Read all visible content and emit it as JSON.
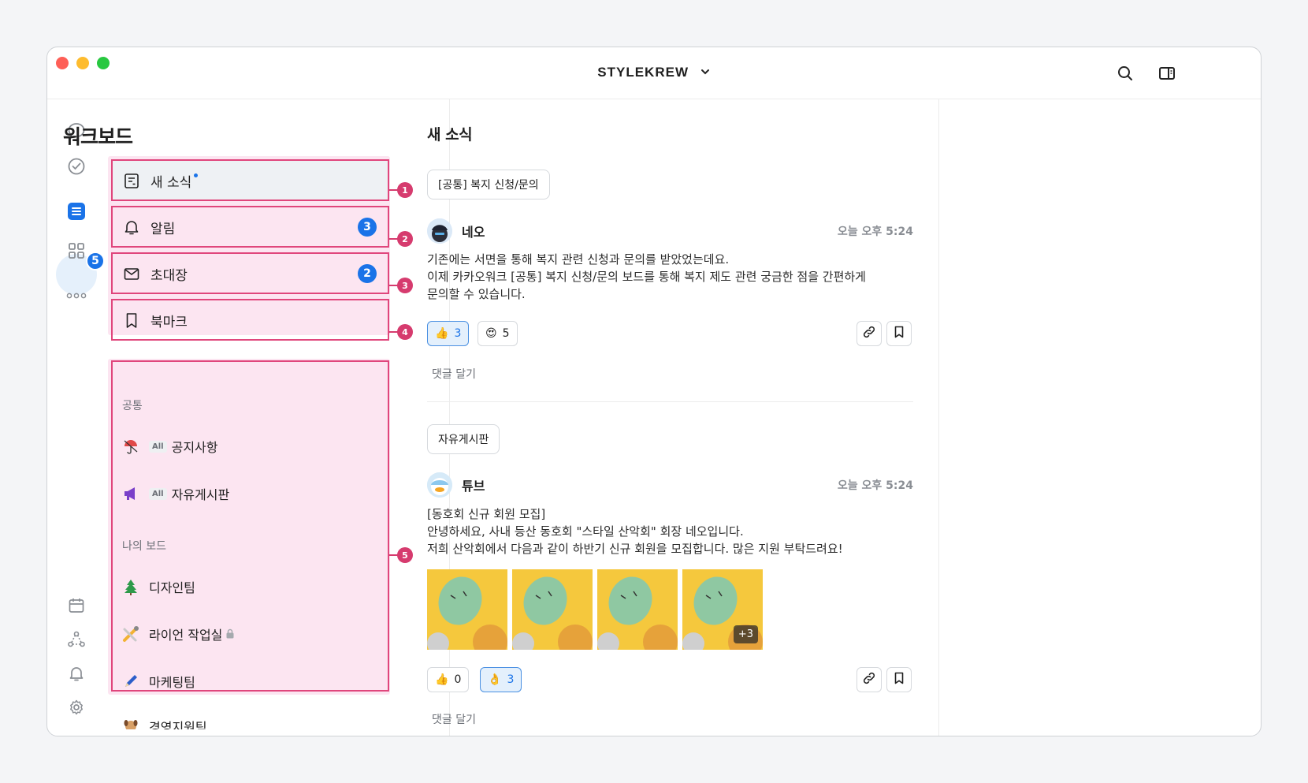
{
  "window": {
    "workspace_name": "STYLEKREW"
  },
  "rail": {
    "board_badge": "5"
  },
  "board_panel": {
    "title": "워크보드",
    "nav": [
      {
        "label": "새 소식",
        "count": ""
      },
      {
        "label": "알림",
        "count": "3"
      },
      {
        "label": "초대장",
        "count": "2"
      },
      {
        "label": "북마크",
        "count": ""
      }
    ],
    "sections": [
      {
        "label": "공통",
        "boards": [
          {
            "label": "공지사항",
            "tag": "All"
          },
          {
            "label": "자유게시판",
            "tag": "All"
          }
        ]
      },
      {
        "label": "나의 보드",
        "boards": [
          {
            "label": "디자인팀"
          },
          {
            "label": "라이언 작업실"
          },
          {
            "label": "마케팅팀"
          },
          {
            "label": "경영지원팀"
          }
        ]
      }
    ]
  },
  "markers": [
    "1",
    "2",
    "3",
    "4",
    "5"
  ],
  "feed": {
    "title": "새 소식",
    "posts": [
      {
        "board": "[공통] 복지 신청/문의",
        "author": "네오",
        "time": "오늘 오후 5:24",
        "text": "기존에는 서면을 통해 복지 관련 신청과 문의를 받았었는데요.\n이제 카카오워크 [공통] 복지 신청/문의 보드를 통해 복지 제도 관련 궁금한 점을 간편하게\n문의할 수 있습니다.",
        "reactions": [
          {
            "emoji": "👍",
            "count": "3",
            "active": true
          },
          {
            "emoji": "😍",
            "count": "5",
            "active": false
          }
        ],
        "comment_label": "댓글 달기"
      },
      {
        "board": "자유게시판",
        "author": "튜브",
        "time": "오늘 오후 5:24",
        "text": "[동호회 신규 회원 모집]\n안녕하세요, 사내 등산 동호회 \"스타일 산악회\" 회장 네오입니다.\n저희 산악회에서 다음과 같이 하반기 신규 회원을 모집합니다. 많은 지원 부탁드려요!",
        "more_images": "+3",
        "reactions": [
          {
            "emoji": "👍",
            "count": "0",
            "active": false
          },
          {
            "emoji": "👌",
            "count": "3",
            "active": true
          }
        ],
        "comment_label": "댓글 달기"
      }
    ]
  },
  "colors": {
    "accent": "#1a73e8",
    "highlight": "#e0467c",
    "marker": "#d63b6e"
  }
}
